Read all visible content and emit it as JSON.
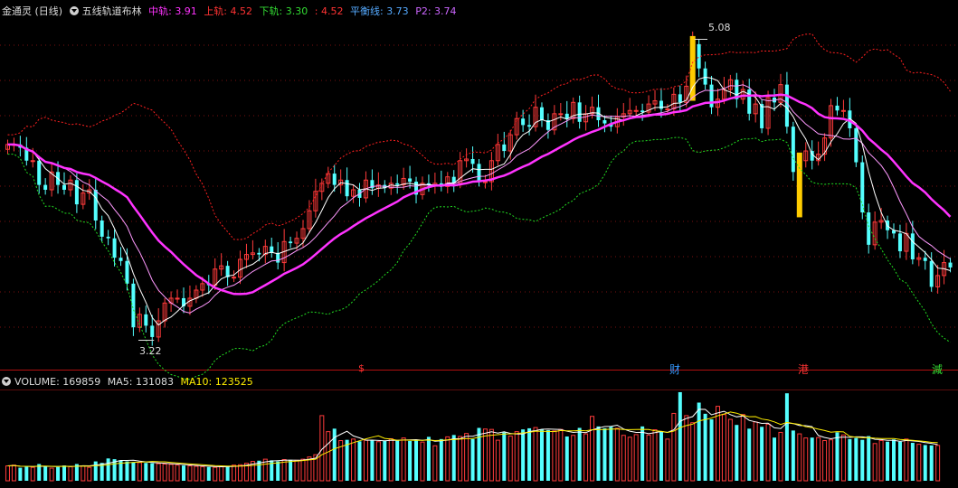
{
  "header": {
    "title": "金通灵 (日线)",
    "indicator": "五线轨道布林",
    "mid_label": "中轨:",
    "mid_value": "3.91",
    "upper_label": "上轨:",
    "upper_value": "4.52",
    "lower_label": "下轨:",
    "lower_value": "3.30",
    "extra_label": ":",
    "extra_value": "4.52",
    "balance_label": "平衡线:",
    "balance_value": "3.73",
    "p2_label": "P2:",
    "p2_value": "3.74"
  },
  "volume_header": {
    "vol_label": "VOLUME:",
    "vol_value": "169859",
    "ma5_label": "MA5:",
    "ma5_value": "131083",
    "ma10_label": "MA10:",
    "ma10_value": "123525"
  },
  "annotations": {
    "high": "5.08",
    "low": "3.22"
  },
  "markers": [
    "$",
    "财",
    "港",
    "減"
  ],
  "colors": {
    "up": "#ff3b3b",
    "down": "#54ffff",
    "mid": "#ff33ff",
    "balance": "#ffffff",
    "p2": "#ff99ff",
    "upper": "#ff2020",
    "lower": "#22dd22",
    "ma5": "#ffffff",
    "ma10": "#ffee00",
    "highlight": "#ffcc00",
    "grid": "#7a1010"
  },
  "chart_data": {
    "type": "candlestick",
    "ylim": [
      3.1,
      5.2
    ],
    "close": [
      4.43,
      4.43,
      4.41,
      4.33,
      4.33,
      4.18,
      4.15,
      4.26,
      4.18,
      4.15,
      4.21,
      4.06,
      4.13,
      4.15,
      3.96,
      3.86,
      3.85,
      3.73,
      3.71,
      3.57,
      3.3,
      3.38,
      3.31,
      3.24,
      3.34,
      3.45,
      3.48,
      3.48,
      3.43,
      3.48,
      3.53,
      3.57,
      3.56,
      3.66,
      3.68,
      3.61,
      3.61,
      3.72,
      3.75,
      3.76,
      3.75,
      3.8,
      3.76,
      3.7,
      3.83,
      3.82,
      3.85,
      3.91,
      4.02,
      4.14,
      4.19,
      4.25,
      4.18,
      4.21,
      4.11,
      4.15,
      4.1,
      4.21,
      4.16,
      4.18,
      4.16,
      4.19,
      4.18,
      4.22,
      4.2,
      4.12,
      4.19,
      4.18,
      4.19,
      4.17,
      4.23,
      4.19,
      4.33,
      4.34,
      4.31,
      4.2,
      4.2,
      4.33,
      4.43,
      4.39,
      4.49,
      4.59,
      4.55,
      4.54,
      4.66,
      4.58,
      4.52,
      4.62,
      4.62,
      4.59,
      4.69,
      4.57,
      4.62,
      4.66,
      4.58,
      4.56,
      4.54,
      4.6,
      4.62,
      4.64,
      4.64,
      4.63,
      4.68,
      4.7,
      4.65,
      4.65,
      4.74,
      4.69,
      4.79,
      5.05,
      4.9,
      4.8,
      4.66,
      4.71,
      4.77,
      4.83,
      4.71,
      4.77,
      4.62,
      4.68,
      4.53,
      4.72,
      4.69,
      4.8,
      4.54,
      4.26,
      4.33,
      4.39,
      4.33,
      4.37,
      4.47,
      4.67,
      4.64,
      4.64,
      4.53,
      4.32,
      4.01,
      3.81,
      3.95,
      3.96,
      3.9,
      3.88,
      3.77,
      3.88,
      3.72,
      3.73,
      3.71,
      3.55,
      3.62,
      3.7,
      3.67
    ],
    "volume": [
      40000,
      42000,
      35000,
      38000,
      36000,
      45000,
      40000,
      34000,
      37000,
      41000,
      38000,
      45000,
      40000,
      36000,
      52000,
      48000,
      60000,
      58000,
      55000,
      52000,
      50000,
      49000,
      48000,
      47000,
      46000,
      45000,
      44000,
      42000,
      41000,
      40000,
      39000,
      38000,
      37000,
      36000,
      38000,
      40000,
      42000,
      43000,
      47000,
      52000,
      54000,
      58000,
      55000,
      52000,
      57000,
      56000,
      55000,
      58000,
      64000,
      70000,
      175000,
      132000,
      140000,
      108000,
      110000,
      112000,
      106000,
      109000,
      109000,
      105000,
      107000,
      113000,
      108000,
      115000,
      107000,
      109000,
      104000,
      118000,
      94000,
      112000,
      118000,
      123000,
      119000,
      127000,
      112000,
      142000,
      139000,
      138000,
      109000,
      130000,
      120000,
      132000,
      138000,
      141000,
      143000,
      138000,
      136000,
      134000,
      138000,
      119000,
      122000,
      142000,
      126000,
      173000,
      146000,
      141000,
      145000,
      141000,
      122000,
      117000,
      124000,
      146000,
      123000,
      137000,
      131000,
      112000,
      181000,
      238000,
      175000,
      156000,
      210000,
      180000,
      165000,
      200000,
      178000,
      165000,
      150000,
      178000,
      140000,
      158000,
      145000,
      152000,
      116000,
      130000,
      235000,
      135000,
      126000,
      115000,
      116000,
      116000,
      108000,
      110000,
      130000,
      123000,
      112000,
      115000,
      110000,
      120000,
      100000,
      108000,
      105000,
      111000,
      105000,
      112000,
      102000,
      98000,
      96000,
      95000,
      95000
    ],
    "mid_rail_last": 3.91,
    "upper_rail_last": 4.52,
    "lower_rail_last": 3.3,
    "balance_last": 3.73,
    "p2_last": 3.74
  }
}
